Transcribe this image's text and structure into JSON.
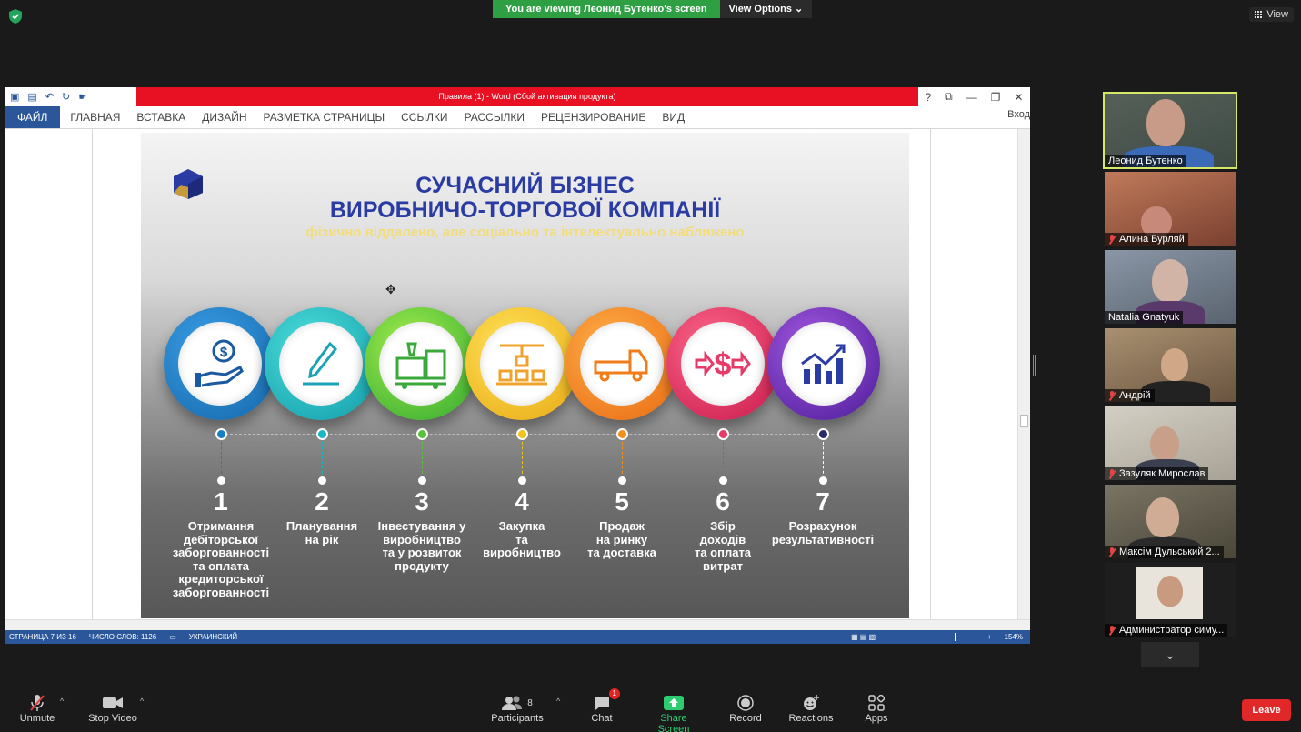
{
  "banner": {
    "viewing": "You are viewing Леонид Бутенко's screen",
    "view_options": "View Options ⌄",
    "view_label": "View"
  },
  "word": {
    "title": "Правила (1) - Word (Сбой активации продукта)",
    "file_tab": "ФАЙЛ",
    "tabs": [
      "ГЛАВНАЯ",
      "ВСТАВКА",
      "ДИЗАЙН",
      "РАЗМЕТКА СТРАНИЦЫ",
      "ССЫЛКИ",
      "РАССЫЛКИ",
      "РЕЦЕНЗИРОВАНИЕ",
      "ВИД"
    ],
    "sign_in": "Вход",
    "status": {
      "page": "СТРАНИЦА 7 ИЗ 16",
      "words": "ЧИСЛО СЛОВ: 1126",
      "lang": "УКРАИНСКИЙ",
      "zoom": "154%"
    }
  },
  "slide": {
    "title1": "СУЧАСНИЙ БІЗНЕС",
    "title2": "ВИРОБНИЧО-ТОРГОВОЇ КОМПАНІЇ",
    "subtitle": "фізично віддалено, але соціально та інтелектуально наближено",
    "steps": [
      {
        "num": "1",
        "text": "Отримання\nдебіторської\nзаборгованності\nта оплата\nкредиторської\nзаборгованності",
        "color": "#1a7fc1",
        "icon": "hand-money-icon"
      },
      {
        "num": "2",
        "text": "Планування\nна рік",
        "color": "#19b7c4",
        "icon": "pen-icon"
      },
      {
        "num": "3",
        "text": "Інвестування у\nвиробництво\nта у розвиток\nпродукту",
        "color": "#58c23a",
        "icon": "machine-icon"
      },
      {
        "num": "4",
        "text": "Закупка\nта\nвиробництво",
        "color": "#f2c318",
        "icon": "conveyor-icon"
      },
      {
        "num": "5",
        "text": "Продаж\nна ринку\nта доставка",
        "color": "#f39019",
        "icon": "truck-icon"
      },
      {
        "num": "6",
        "text": "Збір\nдоходів\nта оплата\nвитрат",
        "color": "#e83a68",
        "icon": "money-exchange-icon"
      },
      {
        "num": "7",
        "text": "Розрахунок\nрезультативності",
        "color": "#6a2ea8",
        "icon": "growth-chart-icon"
      }
    ]
  },
  "participants": [
    {
      "name": "Леонид Бутенко",
      "muted": false,
      "bg": "#4a5a50"
    },
    {
      "name": "Алина Бурляй",
      "muted": true,
      "bg": "#b06a4a"
    },
    {
      "name": "Natalia Gnatyuk",
      "muted": false,
      "bg": "#7a8696"
    },
    {
      "name": "Андрій",
      "muted": true,
      "bg": "#9a8766"
    },
    {
      "name": "Зазуляк Мирослав",
      "muted": true,
      "bg": "#c9c4b8"
    },
    {
      "name": "Максім Дульський 2...",
      "muted": true,
      "bg": "#6e6a5c"
    },
    {
      "name": "Администратор симу...",
      "muted": true,
      "bg": "#2a2a2a"
    }
  ],
  "toolbar": {
    "unmute": "Unmute",
    "stop_video": "Stop Video",
    "participants": "Participants",
    "participants_count": "8",
    "chat": "Chat",
    "chat_badge": "1",
    "share_screen": "Share Screen",
    "record": "Record",
    "reactions": "Reactions",
    "apps": "Apps",
    "leave": "Leave"
  }
}
